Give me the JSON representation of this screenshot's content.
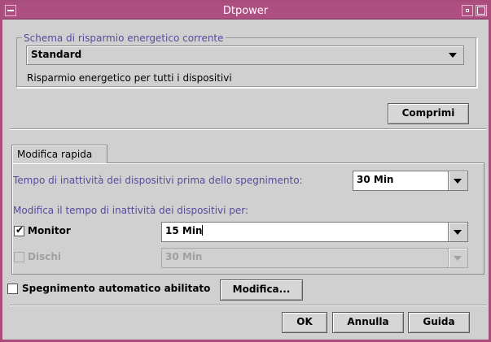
{
  "window": {
    "title": "Dtpower"
  },
  "scheme": {
    "legend": "Schema di risparmio energetico corrente",
    "selected": "Standard",
    "description": "Risparmio energetico per tutti i dispositivi"
  },
  "buttons": {
    "collapse": "Comprimi",
    "modify": "Modifica...",
    "ok": "OK",
    "cancel": "Annulla",
    "help": "Guida"
  },
  "tab": {
    "label": "Modifica rapida"
  },
  "quick_edit": {
    "idle_label": "Tempo di inattività dei dispositivi prima dello spegnimento:",
    "idle_value": "30 Min",
    "per_device_label": "Modifica il tempo di inattività dei dispositivi per:",
    "monitor": {
      "label": "Monitor",
      "checked": true,
      "value": "15 Min"
    },
    "disks": {
      "label": "Dischi",
      "checked": false,
      "enabled": false,
      "value": "30 Min"
    }
  },
  "auto_shutdown": {
    "label": "Spegnimento automatico abilitato",
    "checked": false
  },
  "colors": {
    "titlebar": "#ad4f80",
    "accent_text": "#5a4a9a",
    "background": "#d0d0d0"
  }
}
